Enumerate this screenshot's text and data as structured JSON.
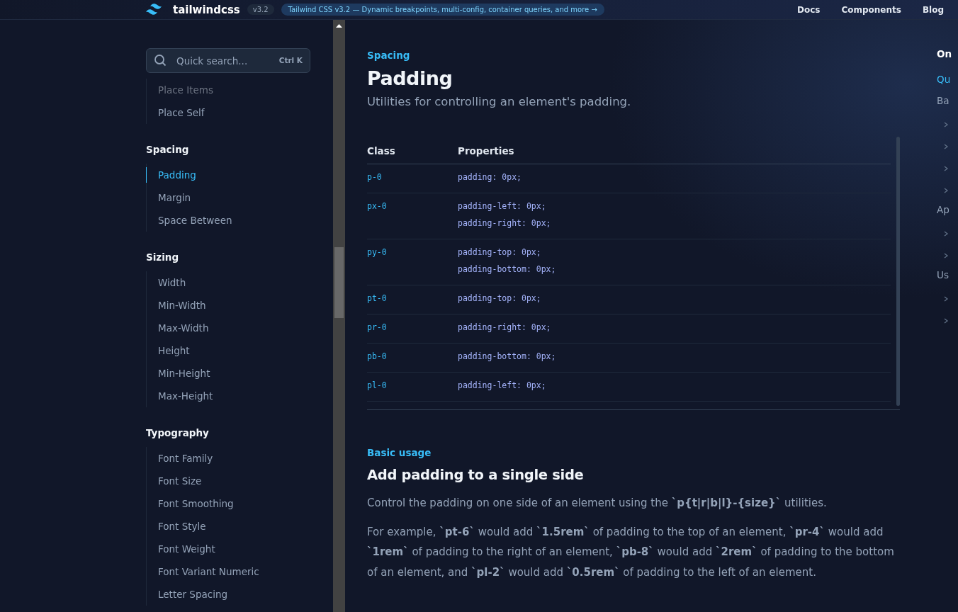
{
  "header": {
    "logo": "tailwindcss",
    "version": "v3.2",
    "announcement": "Tailwind CSS v3.2 — Dynamic breakpoints, multi-config, container queries, and more →",
    "nav": [
      "Docs",
      "Components",
      "Blog"
    ]
  },
  "search": {
    "placeholder": "Quick search...",
    "shortcut": "Ctrl K"
  },
  "sidebar": {
    "sections": [
      {
        "items": [
          {
            "label": "Place Items",
            "selected": false
          },
          {
            "label": "Place Self",
            "selected": false
          }
        ]
      },
      {
        "title": "Spacing",
        "items": [
          {
            "label": "Padding",
            "selected": true
          },
          {
            "label": "Margin",
            "selected": false
          },
          {
            "label": "Space Between",
            "selected": false
          }
        ]
      },
      {
        "title": "Sizing",
        "items": [
          {
            "label": "Width",
            "selected": false
          },
          {
            "label": "Min-Width",
            "selected": false
          },
          {
            "label": "Max-Width",
            "selected": false
          },
          {
            "label": "Height",
            "selected": false
          },
          {
            "label": "Min-Height",
            "selected": false
          },
          {
            "label": "Max-Height",
            "selected": false
          }
        ]
      },
      {
        "title": "Typography",
        "items": [
          {
            "label": "Font Family",
            "selected": false
          },
          {
            "label": "Font Size",
            "selected": false
          },
          {
            "label": "Font Smoothing",
            "selected": false
          },
          {
            "label": "Font Style",
            "selected": false
          },
          {
            "label": "Font Weight",
            "selected": false
          },
          {
            "label": "Font Variant Numeric",
            "selected": false
          },
          {
            "label": "Letter Spacing",
            "selected": false
          }
        ]
      }
    ]
  },
  "page": {
    "eyebrow": "Spacing",
    "title": "Padding",
    "lead": "Utilities for controlling an element's padding."
  },
  "table": {
    "columns": [
      "Class",
      "Properties"
    ],
    "rows": [
      {
        "class": "p-0",
        "properties": [
          "padding: 0px;"
        ]
      },
      {
        "class": "px-0",
        "properties": [
          "padding-left: 0px;",
          "padding-right: 0px;"
        ]
      },
      {
        "class": "py-0",
        "properties": [
          "padding-top: 0px;",
          "padding-bottom: 0px;"
        ]
      },
      {
        "class": "pt-0",
        "properties": [
          "padding-top: 0px;"
        ]
      },
      {
        "class": "pr-0",
        "properties": [
          "padding-right: 0px;"
        ]
      },
      {
        "class": "pb-0",
        "properties": [
          "padding-bottom: 0px;"
        ]
      },
      {
        "class": "pl-0",
        "properties": [
          "padding-left: 0px;"
        ]
      }
    ]
  },
  "section": {
    "eyebrow": "Basic usage",
    "title": "Add padding to a single side",
    "paragraphs": [
      "Control the padding on one side of an element using the **`p{t|r|b|l}-{size}`** utilities.",
      "For example, **`pt-6`** would add **`1.5rem`** of padding to the top of an element, **`pr-4`** would add **`1rem`** of padding to the right of an element, **`pb-8`** would add **`2rem`** of padding to the bottom of an element, and **`pl-2`** would add **`0.5rem`** of padding to the left of an element."
    ]
  },
  "toc": {
    "title": "On",
    "items": [
      {
        "label": "Qu",
        "selected": true
      },
      {
        "label": "Ba",
        "selected": false
      },
      {
        "label": "Ap",
        "selected": false
      },
      {
        "label": "Us",
        "selected": false
      }
    ]
  }
}
